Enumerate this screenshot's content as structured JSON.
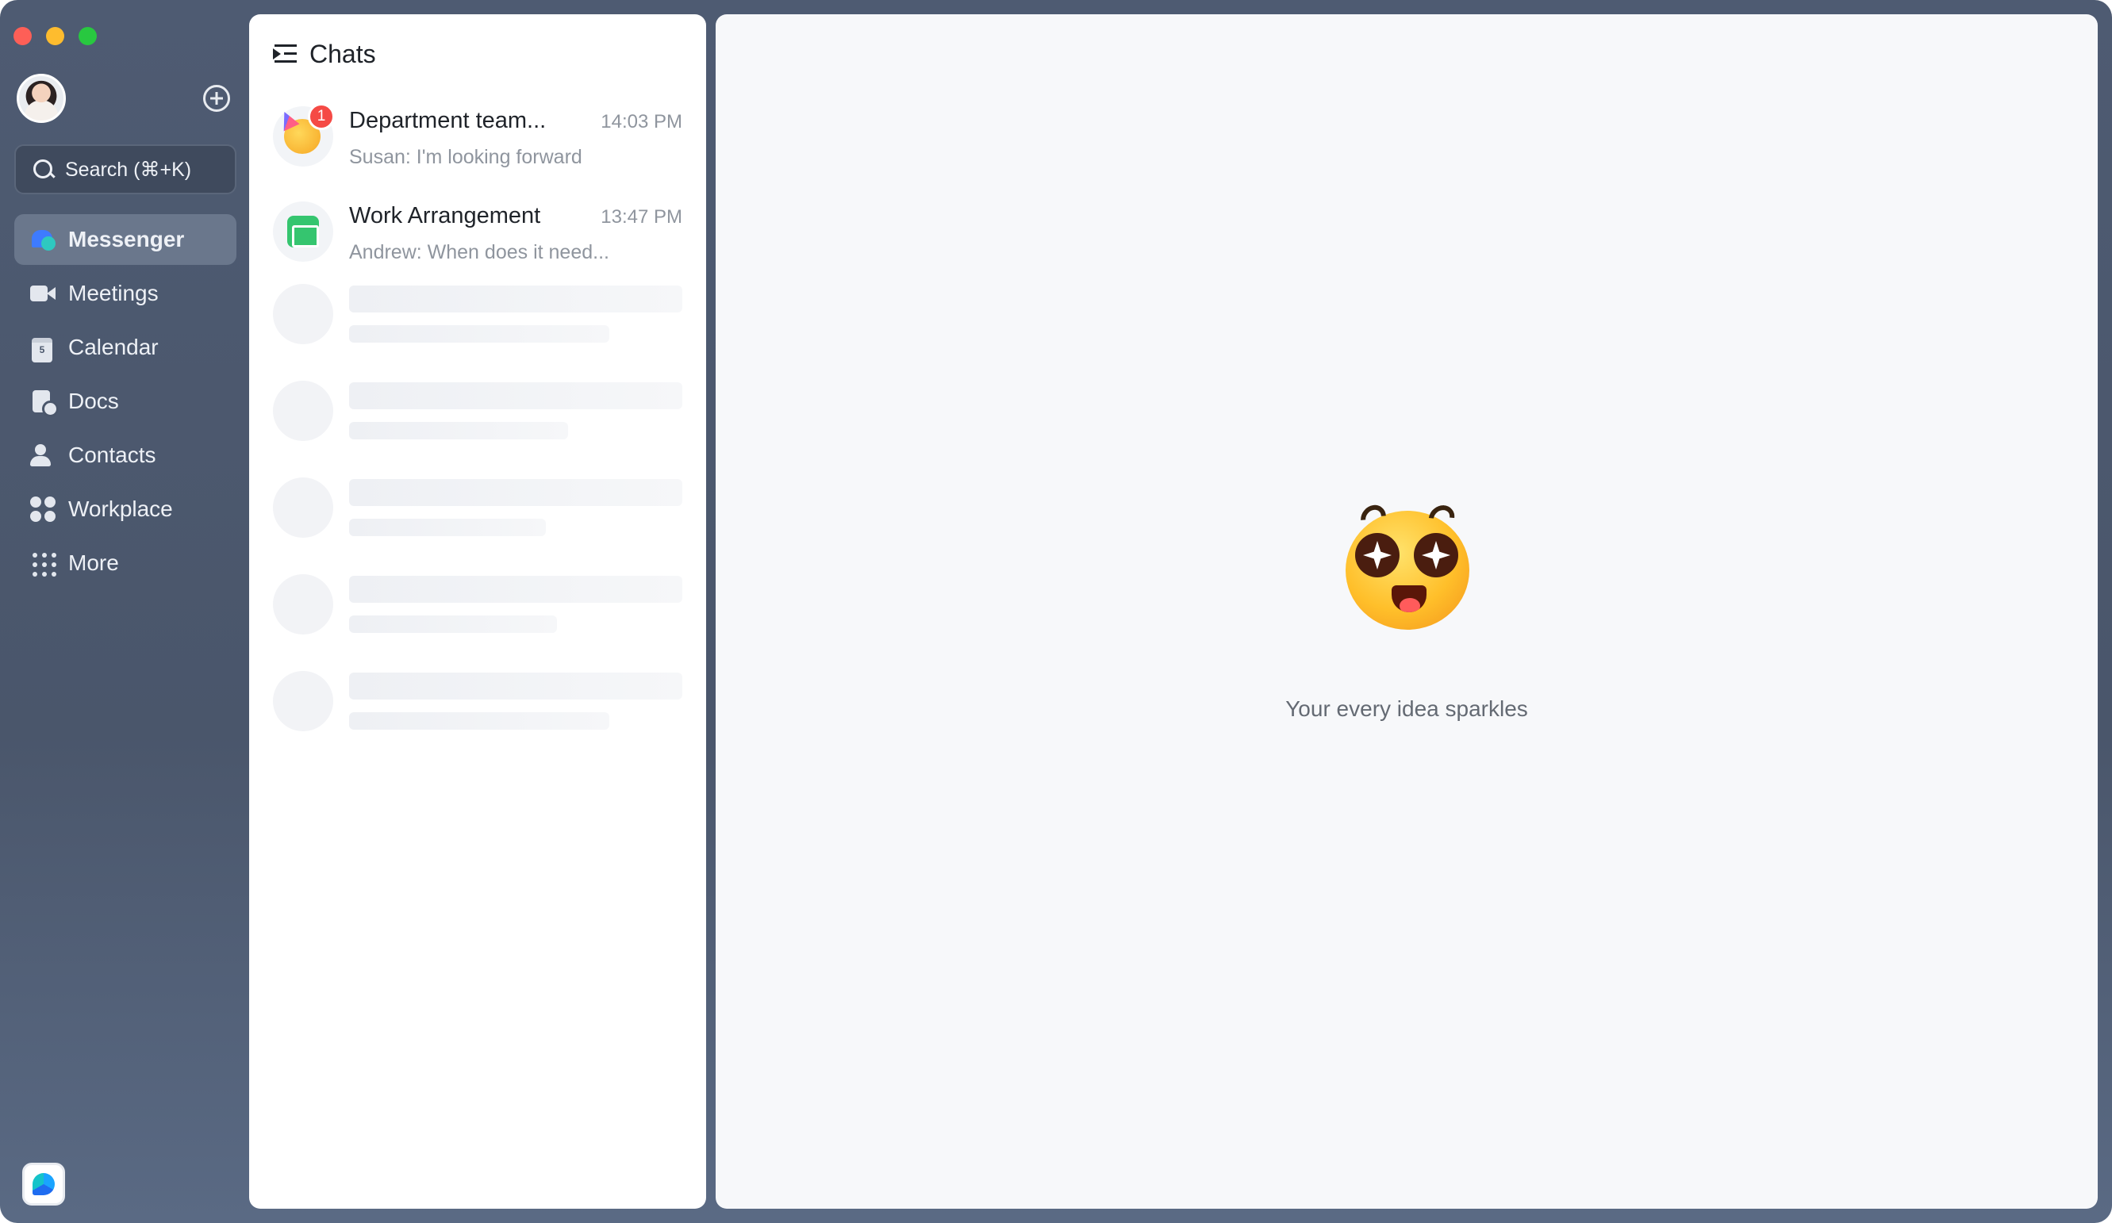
{
  "sidebar": {
    "search": {
      "label": "Search (⌘+K)"
    },
    "nav": [
      {
        "label": "Messenger",
        "icon": "messenger-icon",
        "active": true
      },
      {
        "label": "Meetings",
        "icon": "video-camera-icon"
      },
      {
        "label": "Calendar",
        "icon": "calendar-icon"
      },
      {
        "label": "Docs",
        "icon": "docs-icon"
      },
      {
        "label": "Contacts",
        "icon": "contacts-icon"
      },
      {
        "label": "Workplace",
        "icon": "workplace-grid-icon"
      },
      {
        "label": "More",
        "icon": "more-dots-icon"
      }
    ]
  },
  "chats": {
    "title": "Chats",
    "items": [
      {
        "name": "Department team...",
        "time": "14:03 PM",
        "preview": "Susan: I'm looking forward",
        "unread": "1",
        "avatar_icon": "party-emoji-icon"
      },
      {
        "name": "Work Arrangement",
        "time": "13:47 PM",
        "preview": "Andrew: When does it need...",
        "avatar_icon": "calendar-app-icon"
      }
    ]
  },
  "main": {
    "tagline": "Your every idea sparkles",
    "emoji_icon": "sparkle-eyes-emoji-icon"
  },
  "colors": {
    "sidebar_bg": "#4a566b",
    "active_nav": "#6a778c",
    "unread_badge": "#f54a45",
    "main_bg": "#f7f8fa"
  }
}
